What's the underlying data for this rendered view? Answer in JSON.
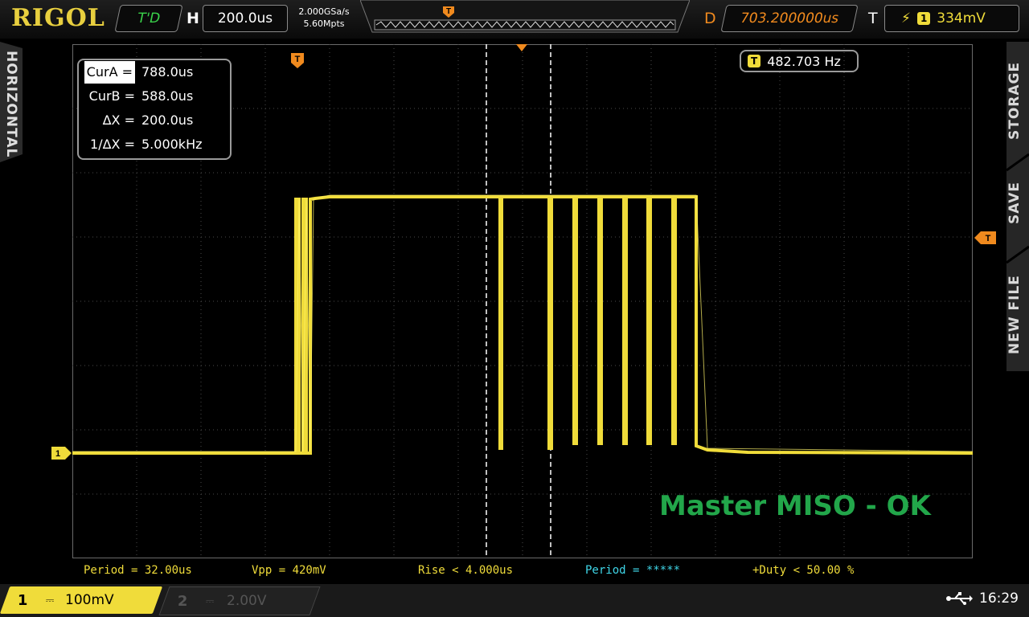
{
  "brand": "RIGOL",
  "top": {
    "trigger_status": "T'D",
    "h_label": "H",
    "timebase": "200.0us",
    "sample_rate": "2.000GSa/s",
    "mem_depth": "5.60Mpts",
    "d_label": "D",
    "delay": "703.200000us",
    "t_label": "T",
    "trig_channel": "1",
    "trig_level": "334mV",
    "trig_marker": "T"
  },
  "side": {
    "horizontal": "HORIZONTAL",
    "storage": "STORAGE",
    "save": "SAVE",
    "new_file": "NEW FILE"
  },
  "cursor": {
    "cura_label": "CurA =",
    "cura_value": "788.0us",
    "curb_label": "CurB =",
    "curb_value": "588.0us",
    "dx_label": "ΔX =",
    "dx_value": "200.0us",
    "inv_dx_label": "1/ΔX =",
    "inv_dx_value": "5.000kHz"
  },
  "frequency": {
    "marker": "T",
    "value": "482.703 Hz"
  },
  "markers": {
    "ch1": "1",
    "trigger_level": "T",
    "trigger_pos": "T"
  },
  "watermark": "Master MISO - OK",
  "measurements": [
    "Period = 32.00us",
    "Vpp = 420mV",
    "Rise < 4.000us",
    "Period = *****",
    "+Duty < 50.00 %"
  ],
  "channels": {
    "ch1_number": "1",
    "ch1_coupling": "⎓",
    "ch1_scale": "100mV",
    "ch2_number": "2",
    "ch2_coupling": "⎓",
    "ch2_scale": "2.00V"
  },
  "status": {
    "time": "16:29",
    "usb_icon": "usb-icon"
  },
  "colors": {
    "ch1": "#f0dc3a",
    "delay": "#f08a1e",
    "trig_status": "#3ad24a",
    "watermark": "#22a64a",
    "meas_cyan": "#3fd6e8"
  }
}
